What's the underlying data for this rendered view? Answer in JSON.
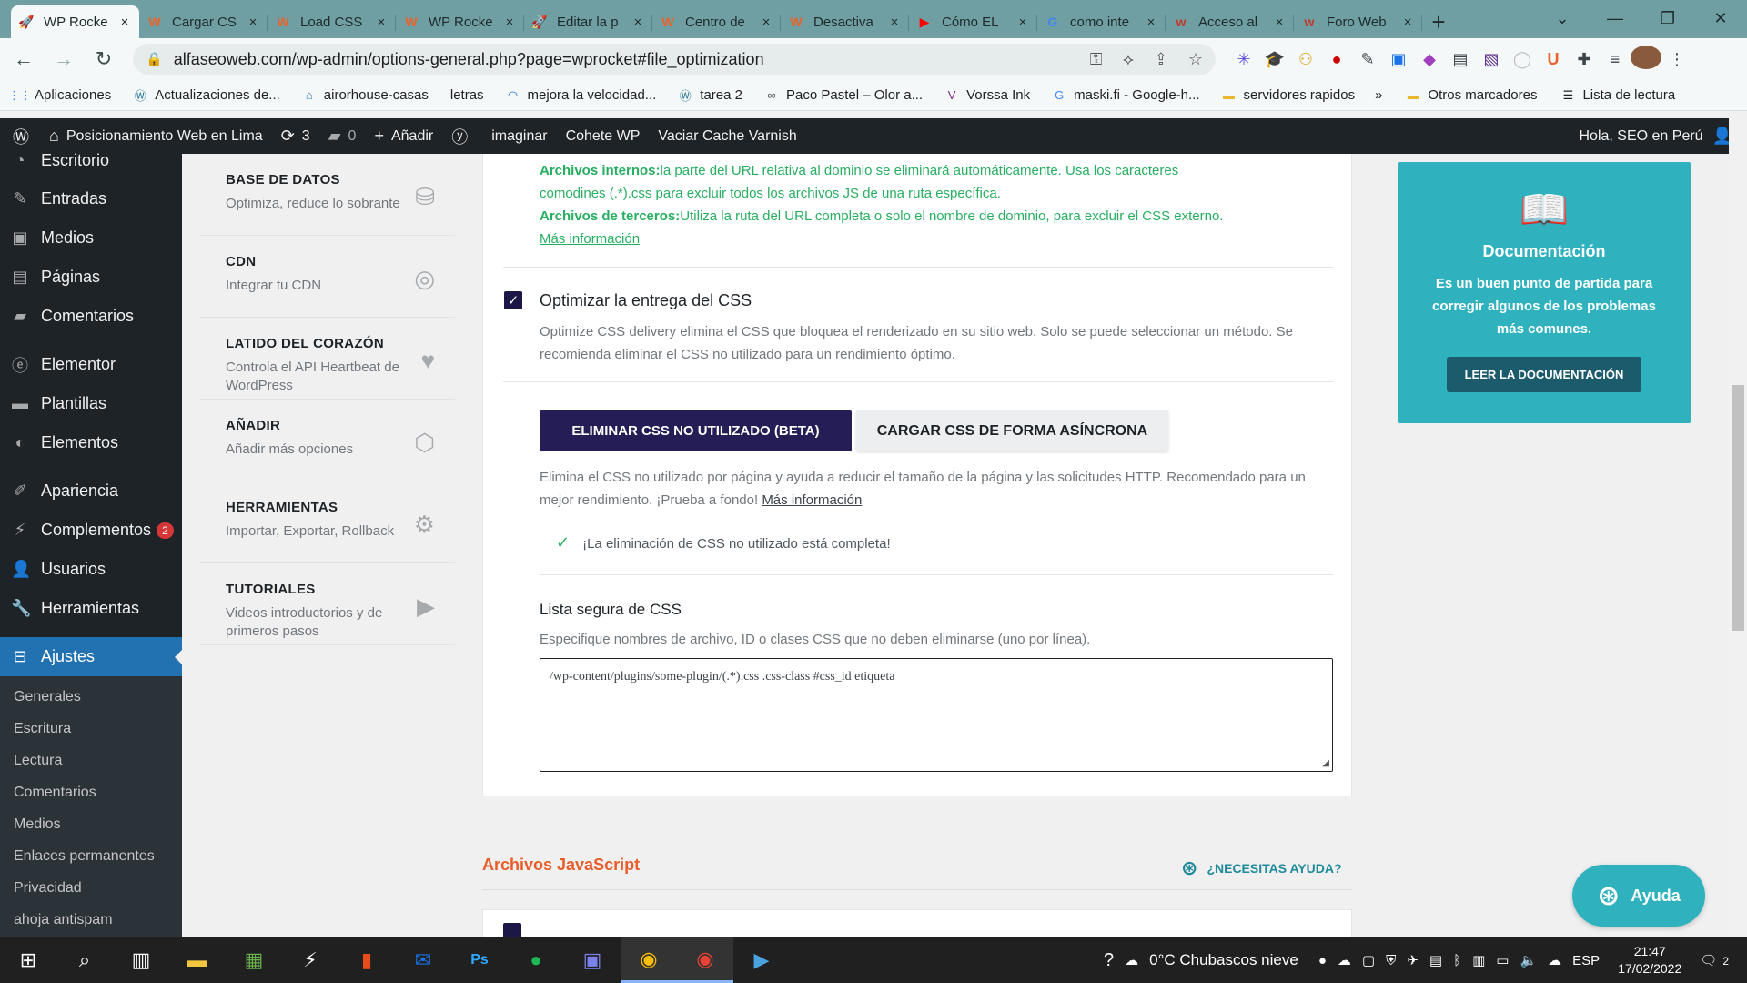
{
  "browser": {
    "tabs": [
      {
        "title": "WP Rocke",
        "icon": "wp-rocket-icon",
        "active": true
      },
      {
        "title": "Cargar CS",
        "icon": "wp-rocket-w-icon"
      },
      {
        "title": "Load CSS",
        "icon": "wp-rocket-w-icon"
      },
      {
        "title": "WP Rocke",
        "icon": "wp-rocket-w-icon"
      },
      {
        "title": "Editar la p",
        "icon": "wp-rocket-icon"
      },
      {
        "title": "Centro de",
        "icon": "wp-rocket-w-icon"
      },
      {
        "title": "Desactiva",
        "icon": "wp-rocket-w-icon"
      },
      {
        "title": "Cómo EL",
        "icon": "youtube-icon"
      },
      {
        "title": "como inte",
        "icon": "google-icon"
      },
      {
        "title": "Acceso al",
        "icon": "woo-icon"
      },
      {
        "title": "Foro Web",
        "icon": "woo-icon"
      }
    ],
    "close_glyph": "×",
    "url": "alfaseoweb.com/wp-admin/options-general.php?page=wprocket#file_optimization",
    "bookmarks": [
      {
        "label": "Aplicaciones",
        "icon": "apps-grid-icon"
      },
      {
        "label": "Actualizaciones de...",
        "icon": "wordpress-icon"
      },
      {
        "label": "airorhouse-casas",
        "icon": "house-icon"
      },
      {
        "label": "letras",
        "icon": ""
      },
      {
        "label": "mejora la velocidad...",
        "icon": "speed-icon"
      },
      {
        "label": "tarea 2",
        "icon": "wordpress-icon"
      },
      {
        "label": "Paco Pastel – Olor a...",
        "icon": "link-icon"
      },
      {
        "label": "Vorssa Ink",
        "icon": "v-icon"
      },
      {
        "label": "maski.fi - Google-h...",
        "icon": "google-icon"
      },
      {
        "label": "servidores rapidos",
        "icon": "folder-icon"
      }
    ],
    "more_bookmarks": "»",
    "other_bookmarks": "Otros marcadores",
    "reading_list": "Lista de lectura"
  },
  "adminbar": {
    "site_name": "Posicionamiento Web en Lima",
    "updates": "3",
    "comments": "0",
    "add_new": "Añadir",
    "links": [
      "imaginar",
      "Cohete WP",
      "Vaciar Cache Varnish"
    ],
    "greeting": "Hola, SEO en Perú"
  },
  "sidebar": {
    "items": [
      {
        "label": "Escritorio",
        "icon": "dashboard-icon"
      },
      {
        "label": "Entradas",
        "icon": "pin-icon"
      },
      {
        "label": "Medios",
        "icon": "media-icon"
      },
      {
        "label": "Páginas",
        "icon": "page-icon"
      },
      {
        "label": "Comentarios",
        "icon": "comment-icon"
      },
      {
        "label": "Elementor",
        "icon": "elementor-icon"
      },
      {
        "label": "Plantillas",
        "icon": "folder-icon"
      },
      {
        "label": "Elementos",
        "icon": "elements-icon"
      },
      {
        "label": "Apariencia",
        "icon": "brush-icon"
      },
      {
        "label": "Complementos",
        "icon": "plugin-icon",
        "badge": "2"
      },
      {
        "label": "Usuarios",
        "icon": "user-icon"
      },
      {
        "label": "Herramientas",
        "icon": "wrench-icon"
      },
      {
        "label": "Ajustes",
        "icon": "settings-icon",
        "current": true
      }
    ],
    "submenu": [
      "Generales",
      "Escritura",
      "Lectura",
      "Comentarios",
      "Medios",
      "Enlaces permanentes",
      "Privacidad",
      "ahoja antispam"
    ]
  },
  "settings_nav": [
    {
      "title": "BASE DE DATOS",
      "desc": "Optimiza, reduce lo sobrante",
      "icon": "database-icon"
    },
    {
      "title": "CDN",
      "desc": "Integrar tu CDN",
      "icon": "cdn-icon"
    },
    {
      "title": "LATIDO DEL CORAZÓN",
      "desc": "Controla el API Heartbeat de WordPress",
      "icon": "heartbeat-icon"
    },
    {
      "title": "AÑADIR",
      "desc": "Añadir más opciones",
      "icon": "addons-icon"
    },
    {
      "title": "HERRAMIENTAS",
      "desc": "Importar, Exportar, Rollback",
      "icon": "tools-icon"
    },
    {
      "title": "TUTORIALES",
      "desc": "Videos introductorios y de primeros pasos",
      "icon": "video-icon"
    }
  ],
  "main": {
    "exclusion_help": {
      "internal_label": "Archivos internos:",
      "internal_text": "la parte del URL relativa al dominio se eliminará automáticamente. Usa los caracteres comodines (.*).css para excluir todos los archivos JS de una ruta específica.",
      "third_label": "Archivos de terceros:",
      "third_text": "Utiliza la ruta del URL completa o solo el nombre de dominio, para excluir el CSS externo.",
      "more": "Más información"
    },
    "css_delivery": {
      "title": "Optimizar la entrega del CSS",
      "desc": "Optimize CSS delivery elimina el CSS que bloquea el renderizado en su sitio web. Solo se puede seleccionar un método. Se recomienda eliminar el CSS no utilizado para un rendimiento óptimo.",
      "btn_remove": "ELIMINAR CSS NO UTILIZADO (BETA)",
      "btn_async": "CARGAR CSS DE FORMA ASÍNCRONA",
      "remove_desc": "Elimina el CSS no utilizado por página y ayuda a reducir el tamaño de la página y las solicitudes HTTP. Recomendado para un mejor rendimiento. ¡Prueba a fondo!",
      "remove_more": "Más información",
      "success": "¡La eliminación de CSS no utilizado está completa!",
      "safelist_title": "Lista segura de CSS",
      "safelist_desc": "Especifique nombres de archivo, ID o clases CSS que no deben eliminarse (uno por línea).",
      "safelist_placeholder": "/wp-content/plugins/some-plugin/(.*).css .css-class #css_id etiqueta"
    },
    "js_section": "Archivos JavaScript",
    "help_link": "¿NECESITAS AYUDA?"
  },
  "docbox": {
    "title": "Documentación",
    "desc": "Es un buen punto de partida para corregir algunos de los problemas más comunes.",
    "button": "LEER LA DOCUMENTACIÓN"
  },
  "ayuda_button": "Ayuda",
  "taskbar": {
    "weather": "0°C  Chubascos nieve",
    "lang": "ESP",
    "time": "21:47",
    "date": "17/02/2022",
    "notifications": "2"
  },
  "colors": {
    "wp_blue": "#2271b1",
    "rocket_purple": "#251d55",
    "teal": "#2fb1be",
    "success_green": "#27ae60",
    "section_orange": "#e85d2a"
  }
}
